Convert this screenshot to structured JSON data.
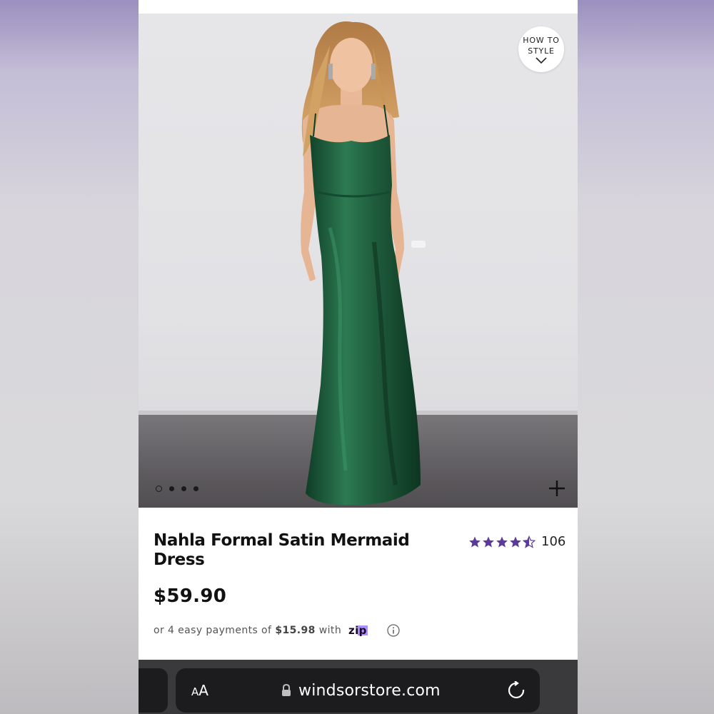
{
  "product": {
    "title": "Nahla Formal Satin Mermaid Dress",
    "price": "$59.90",
    "rating_stars": 4.5,
    "rating_count": "106",
    "how_to_style_line1": "HOW TO",
    "how_to_style_line2": "STYLE",
    "carousel_total": 4,
    "carousel_active": 1
  },
  "payments": {
    "prefix": "or 4 easy payments of",
    "amount": "$15.98",
    "suffix": "with",
    "provider": "zip"
  },
  "browser": {
    "text_size_label_small": "A",
    "text_size_label_large": "A",
    "url": "windsorstore.com"
  },
  "colors": {
    "dress": "#1f5c3c",
    "star": "#5b3a9a",
    "zip_logo": "#1a0826",
    "zip_accent": "#aa8fff"
  },
  "icons": {
    "how_to_chevron": "chevron-down-icon",
    "expand": "plus-icon",
    "info": "info-icon",
    "lock": "lock-icon",
    "reload": "reload-icon"
  }
}
